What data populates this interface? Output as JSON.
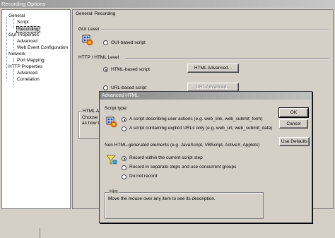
{
  "window": {
    "title": "Recording Options"
  },
  "tree": {
    "items": [
      {
        "label": "General"
      },
      {
        "label": "Script"
      },
      {
        "label": "Recording"
      },
      {
        "label": "GUI Properties"
      },
      {
        "label": "Advanced"
      },
      {
        "label": "Web Event Configuration"
      },
      {
        "label": "Network"
      },
      {
        "label": "Port Mapping"
      },
      {
        "label": "HTTP Properties"
      },
      {
        "label": "Advanced"
      },
      {
        "label": "Correlation"
      }
    ]
  },
  "panel": {
    "header": "General: Recording",
    "gui_level": "GUI Level",
    "gui_radio": "GUI-based script",
    "http_level": "HTTP / HTML Level",
    "html_radio": "HTML-based script",
    "html_adv_btn": "HTML Advanced...",
    "url_radio": "URL-based script",
    "url_adv_btn": "URL Advanced...",
    "partial_group": "HTML A",
    "partial_line1": "Choose",
    "partial_line2": "as how t"
  },
  "dialog": {
    "title": "Advanced HTML",
    "script_type": "Script type:",
    "opt1": "A script describing user actions (e.g. web_link, web_submit_form)",
    "opt2": "A script containing explicit URLs only (e.g. web_url, web_submit_data)",
    "non_html": "Non HTML-generated elements (e.g. JavaScript, VBScript, ActiveX, Applets)",
    "rec1": "Record within the current script step",
    "rec2": "Record in separate steps and use concurrent groups",
    "rec3": "Do not record",
    "ok": "OK",
    "cancel": "Cancel",
    "use_defaults": "Use Defaults",
    "hint_label": "Hint",
    "hint_text": "Move the mouse over any item to see its description."
  }
}
